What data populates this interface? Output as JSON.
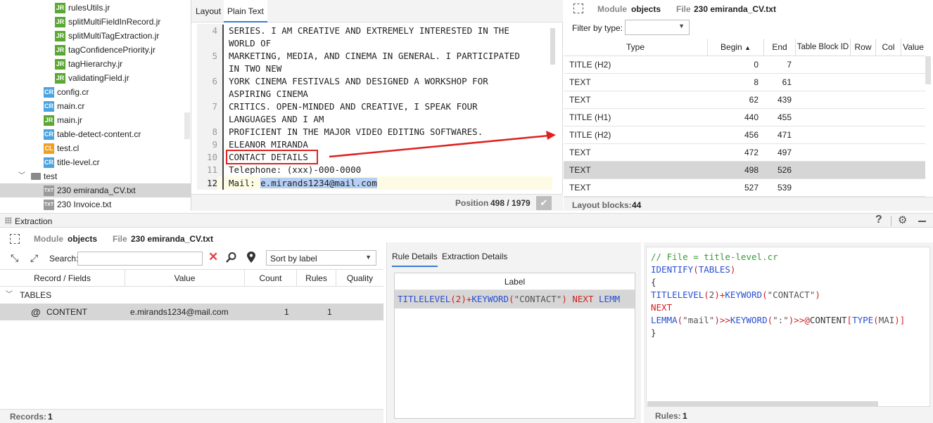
{
  "tree": {
    "items": [
      {
        "badge": "JR",
        "label": "rulesUtils.jr"
      },
      {
        "badge": "JR",
        "label": "splitMultiFieldInRecord.jr"
      },
      {
        "badge": "JR",
        "label": "splitMultiTagExtraction.jr"
      },
      {
        "badge": "JR",
        "label": "tagConfidencePriority.jr"
      },
      {
        "badge": "JR",
        "label": "tagHierarchy.jr"
      },
      {
        "badge": "JR",
        "label": "validatingField.jr"
      },
      {
        "badge": "CR",
        "label": "config.cr"
      },
      {
        "badge": "CR",
        "label": "main.cr"
      },
      {
        "badge": "JR",
        "label": "main.jr"
      },
      {
        "badge": "CR",
        "label": "table-detect-content.cr"
      },
      {
        "badge": "CL",
        "label": "test.cl"
      },
      {
        "badge": "CR",
        "label": "title-level.cr"
      },
      {
        "badge": "",
        "label": "test"
      },
      {
        "badge": "TXT",
        "label": "230 emiranda_CV.txt"
      },
      {
        "badge": "TXT",
        "label": "230 Invoice.txt"
      }
    ]
  },
  "editor": {
    "tabs": [
      "Layout",
      "Plain Text"
    ],
    "lines": [
      {
        "num": "4",
        "text": "SERIES. I AM CREATIVE AND EXTREMELY INTERESTED IN THE"
      },
      {
        "num": "",
        "text": "WORLD OF"
      },
      {
        "num": "5",
        "text": "MARKETING, MEDIA, AND CINEMA IN GENERAL. I PARTICIPATED"
      },
      {
        "num": "",
        "text": "IN TWO NEW"
      },
      {
        "num": "6",
        "text": "YORK CINEMA FESTIVALS AND DESIGNED A WORKSHOP FOR"
      },
      {
        "num": "",
        "text": "ASPIRING CINEMA"
      },
      {
        "num": "7",
        "text": "CRITICS. OPEN-MINDED AND CREATIVE, I SPEAK FOUR"
      },
      {
        "num": "",
        "text": "LANGUAGES AND I AM"
      },
      {
        "num": "8",
        "text": "PROFICIENT IN THE MAJOR VIDEO EDITING SOFTWARES."
      },
      {
        "num": "9",
        "text": "ELEANOR MIRANDA"
      },
      {
        "num": "10",
        "text": "CONTACT DETAILS"
      },
      {
        "num": "11",
        "text": "Telephone: (xxx)-000-0000"
      }
    ],
    "line12_num": "12",
    "line12_prefix": "Mail: ",
    "line12_selected": "e.mirands1234@mail.com",
    "position_label": "Position",
    "position_value": "498 / 1979"
  },
  "objects": {
    "module_label": "Module",
    "module_value": "objects",
    "file_label": "File",
    "file_value": "230 emiranda_CV.txt",
    "filter_label": "Filter by type:",
    "columns": [
      "Type",
      "Begin",
      "End",
      "Table Block ID",
      "Row",
      "Col",
      "Value"
    ],
    "rows": [
      {
        "type": "TITLE (H2)",
        "begin": "0",
        "end": "7"
      },
      {
        "type": "TEXT",
        "begin": "8",
        "end": "61"
      },
      {
        "type": "TEXT",
        "begin": "62",
        "end": "439"
      },
      {
        "type": "TITLE (H1)",
        "begin": "440",
        "end": "455"
      },
      {
        "type": "TITLE (H2)",
        "begin": "456",
        "end": "471"
      },
      {
        "type": "TEXT",
        "begin": "472",
        "end": "497"
      },
      {
        "type": "TEXT",
        "begin": "498",
        "end": "526"
      },
      {
        "type": "TEXT",
        "begin": "527",
        "end": "539"
      }
    ],
    "selected_row": 6,
    "blocks_label": "Layout blocks:",
    "blocks_value": "44"
  },
  "extraction": {
    "title": "Extraction",
    "module_label": "Module",
    "module_value": "objects",
    "file_label": "File",
    "file_value": "230 emiranda_CV.txt",
    "search_label": "Search:",
    "sort_value": "Sort by label",
    "columns": [
      "Record / Fields",
      "Value",
      "Count",
      "Rules",
      "Quality"
    ],
    "group": "TABLES",
    "record": {
      "name": "CONTENT",
      "value": "e.mirands1234@mail.com",
      "count": "1",
      "rules": "1"
    },
    "records_label": "Records:",
    "records_value": "1"
  },
  "rule_details": {
    "tabs": [
      "Rule Details",
      "Extraction Details"
    ],
    "label_header": "Label",
    "label_parts": [
      {
        "t": "TITLELEVEL",
        "c": "#2a4fd1"
      },
      {
        "t": "(2)",
        "c": "#d02020"
      },
      {
        "t": "+",
        "c": "#d02020"
      },
      {
        "t": "KEYWORD",
        "c": "#2a4fd1"
      },
      {
        "t": "(",
        "c": "#d02020"
      },
      {
        "t": "\"CONTACT\"",
        "c": "#555555"
      },
      {
        "t": ")",
        "c": "#d02020"
      },
      {
        "t": " NEXT ",
        "c": "#d02020"
      },
      {
        "t": "LEMM",
        "c": "#2a4fd1"
      }
    ]
  },
  "code": {
    "lines": [
      [
        {
          "t": "// File = title-level.cr",
          "c": "#3a9a3a"
        }
      ],
      [
        {
          "t": "IDENTIFY",
          "c": "#2a4fd1"
        },
        {
          "t": "(",
          "c": "#d02020"
        },
        {
          "t": "TABLES",
          "c": "#2a4fd1"
        },
        {
          "t": ")",
          "c": "#d02020"
        }
      ],
      [
        {
          "t": "{",
          "c": "#333333"
        }
      ],
      [
        {
          "t": "TITLELEVEL",
          "c": "#2a4fd1"
        },
        {
          "t": "(",
          "c": "#d02020"
        },
        {
          "t": "2",
          "c": "#555555"
        },
        {
          "t": ")",
          "c": "#d02020"
        },
        {
          "t": "+",
          "c": "#d02020"
        },
        {
          "t": "KEYWORD",
          "c": "#2a4fd1"
        },
        {
          "t": "(",
          "c": "#d02020"
        },
        {
          "t": "\"CONTACT\"",
          "c": "#555555"
        },
        {
          "t": ")",
          "c": "#d02020"
        }
      ],
      [
        {
          "t": "NEXT",
          "c": "#d02020"
        }
      ],
      [
        {
          "t": "LEMMA",
          "c": "#2a4fd1"
        },
        {
          "t": "(",
          "c": "#d02020"
        },
        {
          "t": "\"mail\"",
          "c": "#555555"
        },
        {
          "t": ")",
          "c": "#d02020"
        },
        {
          "t": ">>",
          "c": "#d02020"
        },
        {
          "t": "KEYWORD",
          "c": "#2a4fd1"
        },
        {
          "t": "(",
          "c": "#d02020"
        },
        {
          "t": "\":\"",
          "c": "#555555"
        },
        {
          "t": ")",
          "c": "#d02020"
        },
        {
          "t": ">>",
          "c": "#d02020"
        },
        {
          "t": "@",
          "c": "#d02020"
        },
        {
          "t": "CONTENT",
          "c": "#333333"
        },
        {
          "t": "[",
          "c": "#d02020"
        },
        {
          "t": "TYPE",
          "c": "#2a4fd1"
        },
        {
          "t": "(",
          "c": "#d02020"
        },
        {
          "t": "MAI",
          "c": "#555555"
        },
        {
          "t": ")]",
          "c": "#d02020"
        }
      ],
      [
        {
          "t": "}",
          "c": "#333333"
        }
      ]
    ],
    "rules_label": "Rules:",
    "rules_value": "1"
  }
}
